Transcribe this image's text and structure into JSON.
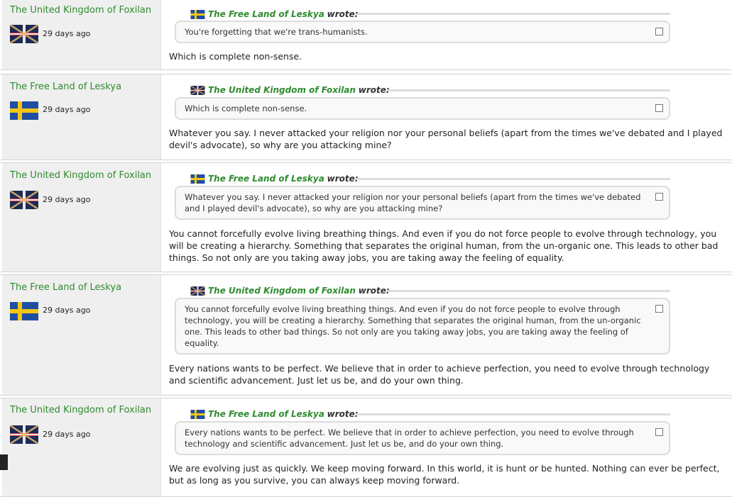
{
  "nations": {
    "foxilan": "The United Kingdom of Foxilan",
    "leskya": "The Free Land of Leskya"
  },
  "wrote_label": "wrote:",
  "posts": [
    {
      "author": "The United Kingdom of Foxilan",
      "flag": "foxilan-flag",
      "time": "29 days ago",
      "quote_author": "The Free Land of Leskya",
      "quote_flag": "leskya-flag",
      "quote": "You're forgetting that we're trans-humanists.",
      "text": "Which is complete non-sense."
    },
    {
      "author": "The Free Land of Leskya",
      "flag": "leskya-flag",
      "time": "29 days ago",
      "quote_author": "The United Kingdom of Foxilan",
      "quote_flag": "foxilan-flag",
      "quote": "Which is complete non-sense.",
      "text": "Whatever you say. I never attacked your religion nor your personal beliefs (apart from the times we've debated and I played devil's advocate), so why are you attacking mine?"
    },
    {
      "author": "The United Kingdom of Foxilan",
      "flag": "foxilan-flag",
      "time": "29 days ago",
      "quote_author": "The Free Land of Leskya",
      "quote_flag": "leskya-flag",
      "quote": "Whatever you say. I never attacked your religion nor your personal beliefs (apart from the times we've debated and I played devil's advocate), so why are you attacking mine?",
      "text": "You cannot forcefully evolve living breathing things. And even if you do not force people to evolve through technology, you will be creating a hierarchy. Something that separates the original human, from the un-organic one. This leads to other bad things. So not only are you taking away jobs, you are taking away the feeling of equality."
    },
    {
      "author": "The Free Land of Leskya",
      "flag": "leskya-flag",
      "time": "29 days ago",
      "quote_author": "The United Kingdom of Foxilan",
      "quote_flag": "foxilan-flag",
      "quote": "You cannot forcefully evolve living breathing things. And even if you do not force people to evolve through technology, you will be creating a hierarchy. Something that separates the original human, from the un-organic one. This leads to other bad things. So not only are you taking away jobs, you are taking away the feeling of equality.",
      "text": "Every nations wants to be perfect. We believe that in order to achieve perfection, you need to evolve through technology and scientific advancement. Just let us be, and do your own thing."
    },
    {
      "author": "The United Kingdom of Foxilan",
      "flag": "foxilan-flag",
      "time": "29 days ago",
      "quote_author": "The Free Land of Leskya",
      "quote_flag": "leskya-flag",
      "quote": "Every nations wants to be perfect. We believe that in order to achieve perfection, you need to evolve through technology and scientific advancement. Just let us be, and do your own thing.",
      "text": "We are evolving just as quickly. We keep moving forward. In this world, it is hunt or be hunted. Nothing can ever be perfect, but as long as you survive, you can always keep moving forward."
    }
  ],
  "colors": {
    "author_link": "#2e8b2e",
    "sidebar_bg": "#efefef",
    "quote_border": "#dcdcdc"
  }
}
